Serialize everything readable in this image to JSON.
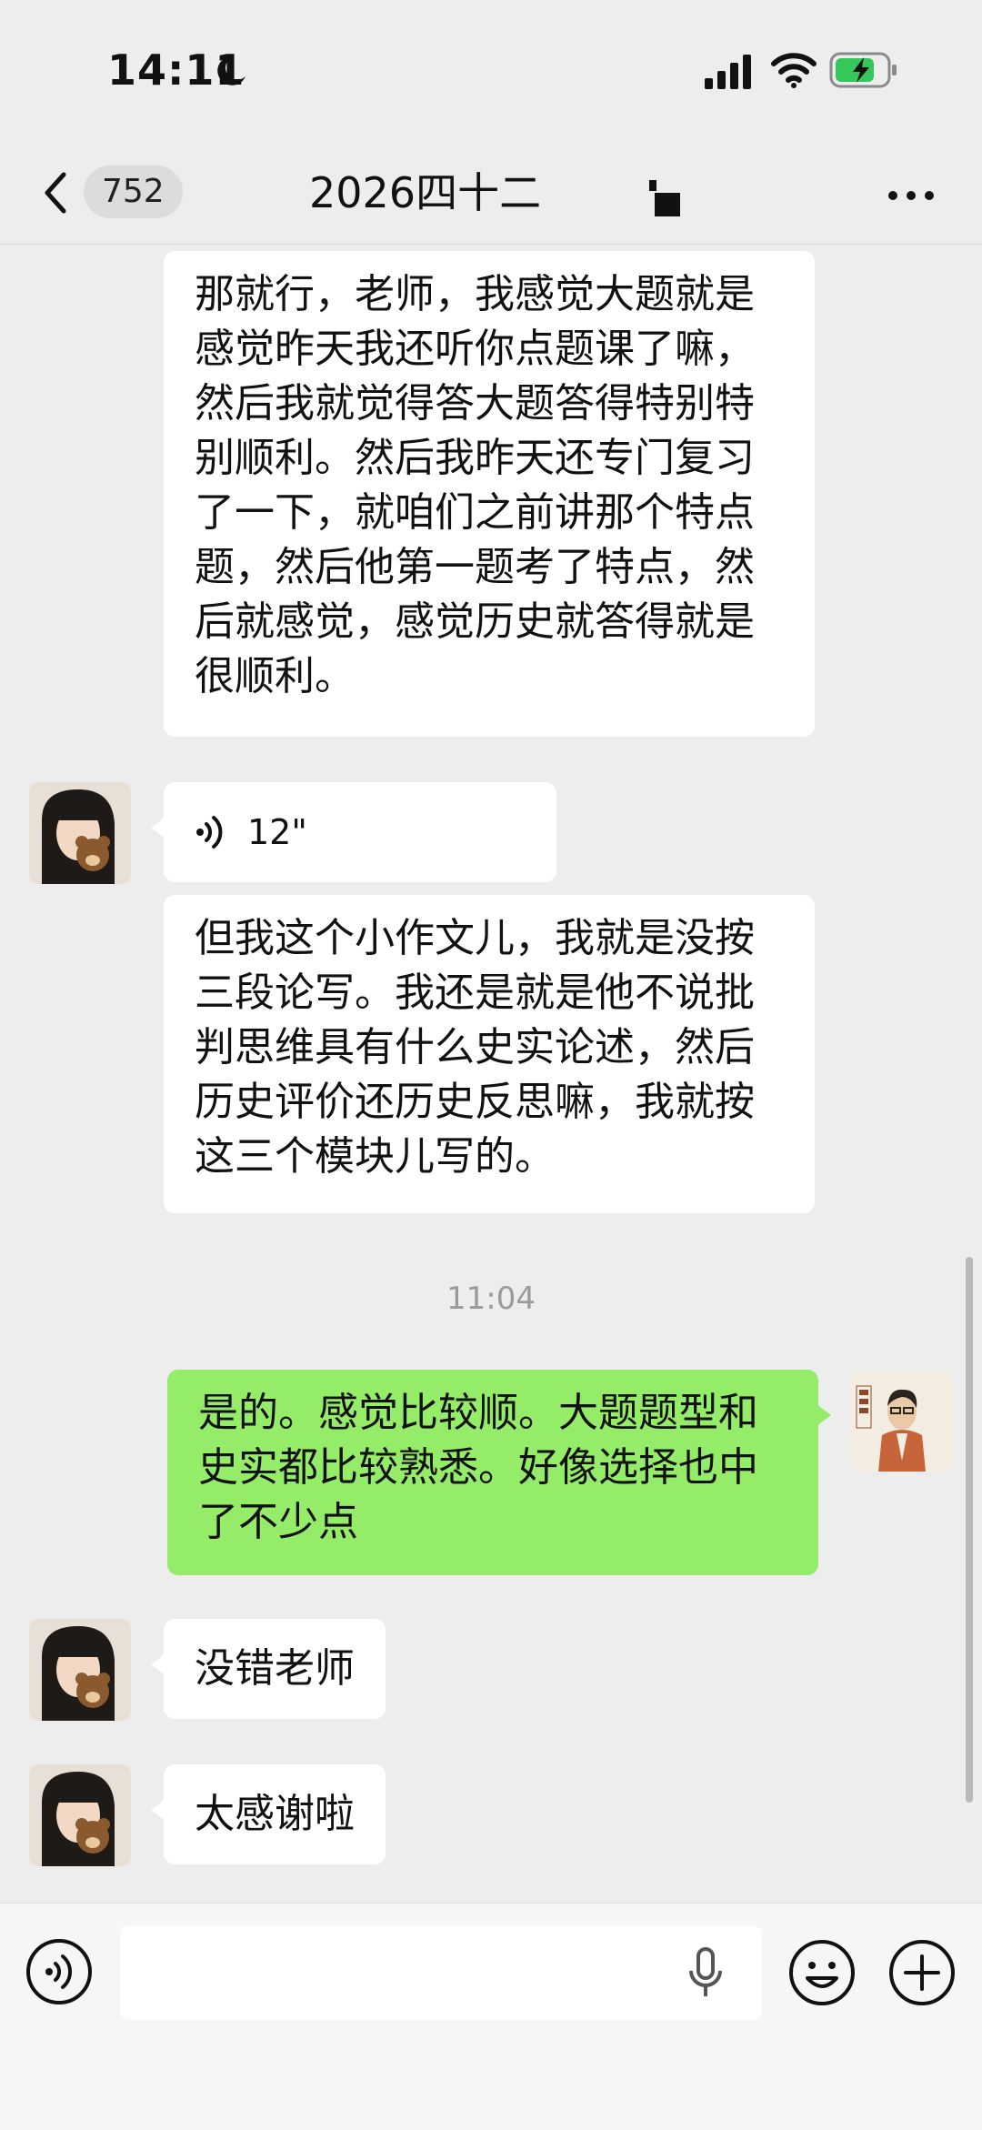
{
  "status_bar": {
    "time": "14:11",
    "icons": [
      "moon-icon",
      "cellular-signal-icon",
      "wifi-icon",
      "battery-charging-icon"
    ]
  },
  "nav": {
    "unread_count": "752",
    "title": "2026四十二",
    "icons": [
      "back-icon",
      "more-icon"
    ]
  },
  "messages": [
    {
      "side": "left",
      "type": "text",
      "text": "那就行，老师，我感觉大题就是感觉昨天我还听你点题课了嘛，然后我就觉得答大题答得特别特别顺利。然后我昨天还专门复习了一下，就咱们之前讲那个特点题，然后他第一题考了特点，然后就感觉，感觉历史就答得就是很顺利。"
    },
    {
      "side": "left",
      "type": "voice",
      "duration": "12\""
    },
    {
      "side": "left",
      "type": "text",
      "text": "但我这个小作文儿，我就是没按三段论写。我还是就是他不说批判思维具有什么史实论述，然后历史评价还历史反思嘛，我就按这三个模块儿写的。"
    },
    {
      "type": "timestamp",
      "text": "11:04"
    },
    {
      "side": "right",
      "type": "text",
      "text": "是的。感觉比较顺。大题题型和史实都比较熟悉。好像选择也中了不少点"
    },
    {
      "side": "left",
      "type": "text",
      "text": "没错老师"
    },
    {
      "side": "left",
      "type": "text",
      "text": "太感谢啦"
    }
  ],
  "input_bar": {
    "value": "",
    "icons": [
      "voice-toggle-icon",
      "mic-icon",
      "emoji-icon",
      "plus-icon"
    ]
  },
  "colors": {
    "background": "#ededed",
    "sent_bubble": "#95ec69",
    "received_bubble": "#ffffff"
  }
}
